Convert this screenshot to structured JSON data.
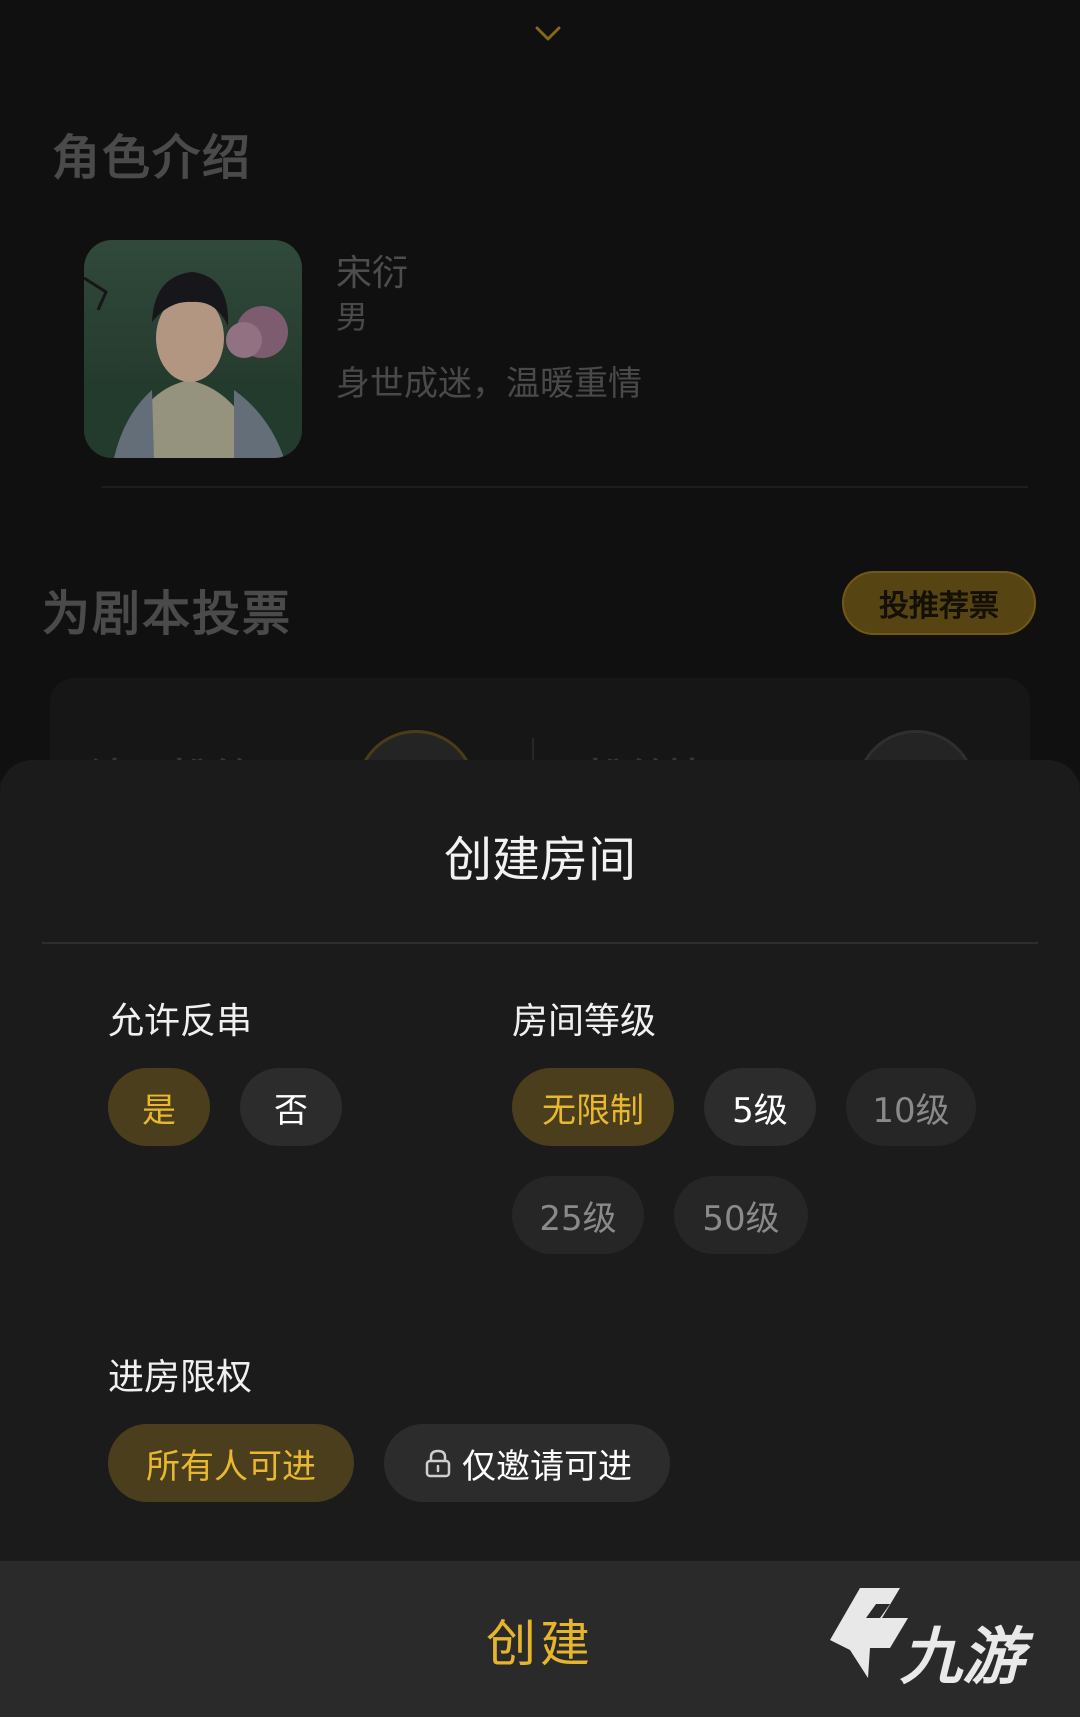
{
  "background": {
    "chevron_icon": "chevron-down-icon",
    "character_section": {
      "title": "角色介绍",
      "name": "宋衍",
      "gender": "男",
      "description": "身世成迷，温暖重情"
    },
    "vote_section": {
      "title": "为剧本投票",
      "button_label": "投推荐票",
      "left_partial": "沈已粉丝",
      "right_partial": "粉丝榜"
    }
  },
  "sheet": {
    "title": "创建房间",
    "groups": {
      "allow_reverse": {
        "label": "允许反串",
        "options": [
          {
            "label": "是",
            "state": "selected"
          },
          {
            "label": "否",
            "state": "normal"
          }
        ]
      },
      "room_level": {
        "label": "房间等级",
        "options": [
          {
            "label": "无限制",
            "state": "selected"
          },
          {
            "label": "5级",
            "state": "normal"
          },
          {
            "label": "10级",
            "state": "disabled"
          },
          {
            "label": "25级",
            "state": "disabled"
          },
          {
            "label": "50级",
            "state": "disabled"
          }
        ]
      },
      "entry_permission": {
        "label": "进房限权",
        "options": [
          {
            "label": "所有人可进",
            "state": "selected"
          },
          {
            "label": "仅邀请可进",
            "state": "normal",
            "icon": "lock-icon"
          }
        ]
      }
    },
    "create_label": "创建",
    "watermark_text": "九游",
    "colors": {
      "accent": "#e9b830",
      "selected_bg": "#4a3e1c",
      "chip_bg": "#2c2c2c",
      "sheet_bg": "#1b1b1b"
    }
  }
}
